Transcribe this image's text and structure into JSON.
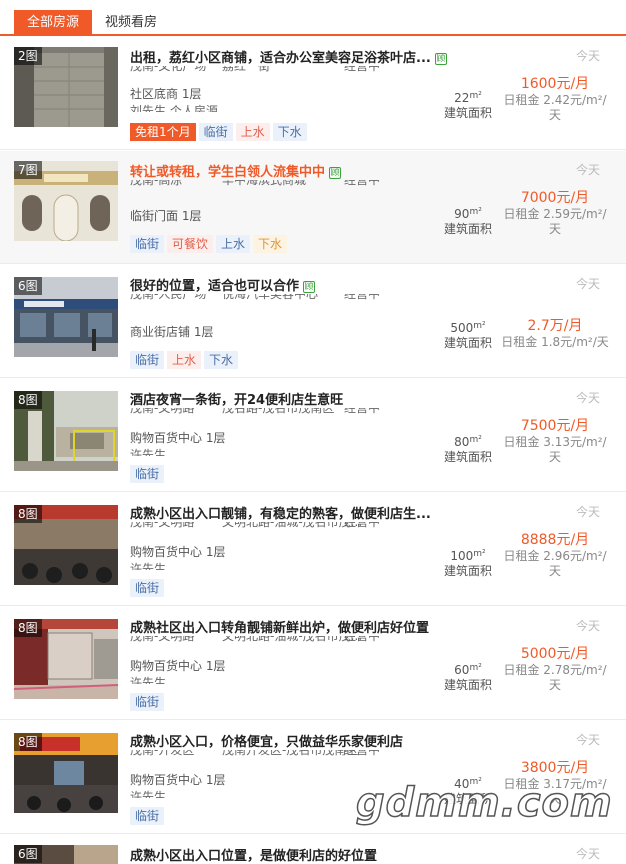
{
  "tabs": {
    "all": "全部房源",
    "video": "视频看房"
  },
  "listings": [
    {
      "photo_count": "2图",
      "title": "出租，荔红小区商铺，适合办公室美容足浴茶叶店...",
      "verified": "顾",
      "addr1": "茂南-文化广场",
      "addr2": "荔红一街",
      "addr3": "经营中",
      "type": "社区底商 1层",
      "contact": "刘先生 个人房源",
      "tags": [
        "免租1个月",
        "临街",
        "上水",
        "下水"
      ],
      "area": "22",
      "area_unit": "m²",
      "area_label": "建筑面积",
      "rent": "1600元/月",
      "daily": "日租金 2.42元/m²/天",
      "date": "今天"
    },
    {
      "photo_count": "7图",
      "title": "转让或转租，学生白领人流集中中",
      "verified": "顾",
      "addr1": "茂南-高凉",
      "addr2": "华中海滨式商城",
      "addr3": "经营中",
      "type": "临街门面 1层",
      "contact": "",
      "tags": [
        "临街",
        "可餐饮",
        "上水",
        "下水"
      ],
      "area": "90",
      "area_unit": "m²",
      "area_label": "建筑面积",
      "rent": "7000元/月",
      "daily": "日租金 2.59元/m²/天",
      "date": "今天"
    },
    {
      "photo_count": "6图",
      "title": "很好的位置，适合也可以合作",
      "verified": "顾",
      "addr1": "茂南-人民广场",
      "addr2": "悦海汽车美容中心",
      "addr3": "经营中",
      "type": "商业街店铺 1层",
      "contact": "",
      "tags": [
        "临街",
        "上水",
        "下水"
      ],
      "area": "500",
      "area_unit": "m²",
      "area_label": "建筑面积",
      "rent": "2.7万/月",
      "daily": "日租金 1.8元/m²/天",
      "date": "今天"
    },
    {
      "photo_count": "8图",
      "title": "酒店夜宵一条街，开24便利店生意旺",
      "verified": "",
      "addr1": "茂南-文明路",
      "addr2": "茂名路-茂名市茂南区",
      "addr3": "经营中",
      "type": "购物百货中心 1层",
      "contact": "许先生",
      "tags": [
        "临街"
      ],
      "area": "80",
      "area_unit": "m²",
      "area_label": "建筑面积",
      "rent": "7500元/月",
      "daily": "日租金 3.13元/m²/天",
      "date": "今天"
    },
    {
      "photo_count": "8图",
      "title": "成熟小区出入口靓铺，有稳定的熟客，做便利店生...",
      "verified": "",
      "addr1": "茂南-文明路",
      "addr2": "文明北路-油城-茂名市茂...",
      "addr3": "经营中",
      "type": "购物百货中心 1层",
      "contact": "许先生",
      "tags": [
        "临街"
      ],
      "area": "100",
      "area_unit": "m²",
      "area_label": "建筑面积",
      "rent": "8888元/月",
      "daily": "日租金 2.96元/m²/天",
      "date": "今天"
    },
    {
      "photo_count": "8图",
      "title": "成熟社区出入口转角靓铺新鲜出炉，做便利店好位置",
      "verified": "",
      "addr1": "茂南-文明路",
      "addr2": "文明北路-油城-茂名市茂...",
      "addr3": "经营中",
      "type": "购物百货中心 1层",
      "contact": "许先生",
      "tags": [
        "临街"
      ],
      "area": "60",
      "area_unit": "m²",
      "area_label": "建筑面积",
      "rent": "5000元/月",
      "daily": "日租金 2.78元/m²/天",
      "date": "今天"
    },
    {
      "photo_count": "8图",
      "title": "成熟小区入口，价格便宜，只做益华乐家便利店",
      "verified": "",
      "addr1": "茂南-开发区",
      "addr2": "茂南开发区-茂名市茂南区",
      "addr3": "经营中",
      "type": "购物百货中心 1层",
      "contact": "许先生",
      "tags": [
        "临街"
      ],
      "area": "40",
      "area_unit": "m²",
      "area_label": "建筑面积",
      "rent": "3800元/月",
      "daily": "日租金 3.17元/m²/天",
      "date": "今天"
    },
    {
      "photo_count": "6图",
      "title": "成熟小区出入口位置，是做便利店的好位置",
      "verified": "",
      "date": "今天"
    }
  ],
  "watermark": "gdmm.com",
  "colors": {
    "accent": "#f05a28",
    "verified": "#3aa33a",
    "tag_blue": "#4a6fa5"
  }
}
